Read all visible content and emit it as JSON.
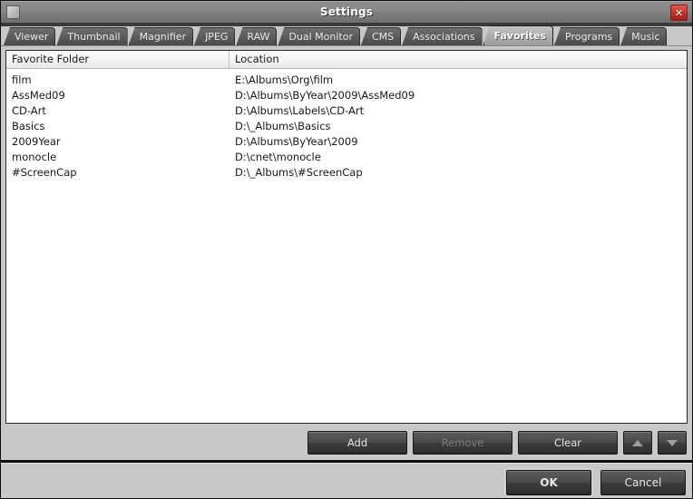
{
  "window": {
    "title": "Settings",
    "app_icon": "app-icon",
    "close_label": "✕"
  },
  "tabs": [
    {
      "label": "Viewer",
      "active": false
    },
    {
      "label": "Thumbnail",
      "active": false
    },
    {
      "label": "Magnifier",
      "active": false
    },
    {
      "label": "JPEG",
      "active": false
    },
    {
      "label": "RAW",
      "active": false
    },
    {
      "label": "Dual Monitor",
      "active": false
    },
    {
      "label": "CMS",
      "active": false
    },
    {
      "label": "Associations",
      "active": false
    },
    {
      "label": "Favorites",
      "active": true
    },
    {
      "label": "Programs",
      "active": false
    },
    {
      "label": "Music",
      "active": false
    }
  ],
  "list": {
    "columns": [
      "Favorite Folder",
      "Location"
    ],
    "rows": [
      {
        "folder": "film",
        "location": "E:\\Albums\\Org\\film"
      },
      {
        "folder": "AssMed09",
        "location": "D:\\Albums\\ByYear\\2009\\AssMed09"
      },
      {
        "folder": "CD-Art",
        "location": "D:\\Albums\\Labels\\CD-Art"
      },
      {
        "folder": "Basics",
        "location": "D:\\_Albums\\Basics"
      },
      {
        "folder": "2009Year",
        "location": "D:\\Albums\\ByYear\\2009"
      },
      {
        "folder": "monocle",
        "location": "D:\\cnet\\monocle"
      },
      {
        "folder": "#ScreenCap",
        "location": "D:\\_Albums\\#ScreenCap"
      }
    ]
  },
  "actions": {
    "add_label": "Add",
    "remove_label": "Remove",
    "remove_disabled": true,
    "clear_label": "Clear",
    "move_up_icon": "triangle-up-icon",
    "move_down_icon": "triangle-down-icon"
  },
  "dialog_buttons": {
    "ok_label": "OK",
    "cancel_label": "Cancel"
  },
  "colors": {
    "window_bg": "#c8c8c8",
    "titlebar": "#808080",
    "close_button": "#c4342c",
    "list_bg": "#ffffff",
    "button_face": "#4a4a4a",
    "active_tab": "#ababab"
  }
}
